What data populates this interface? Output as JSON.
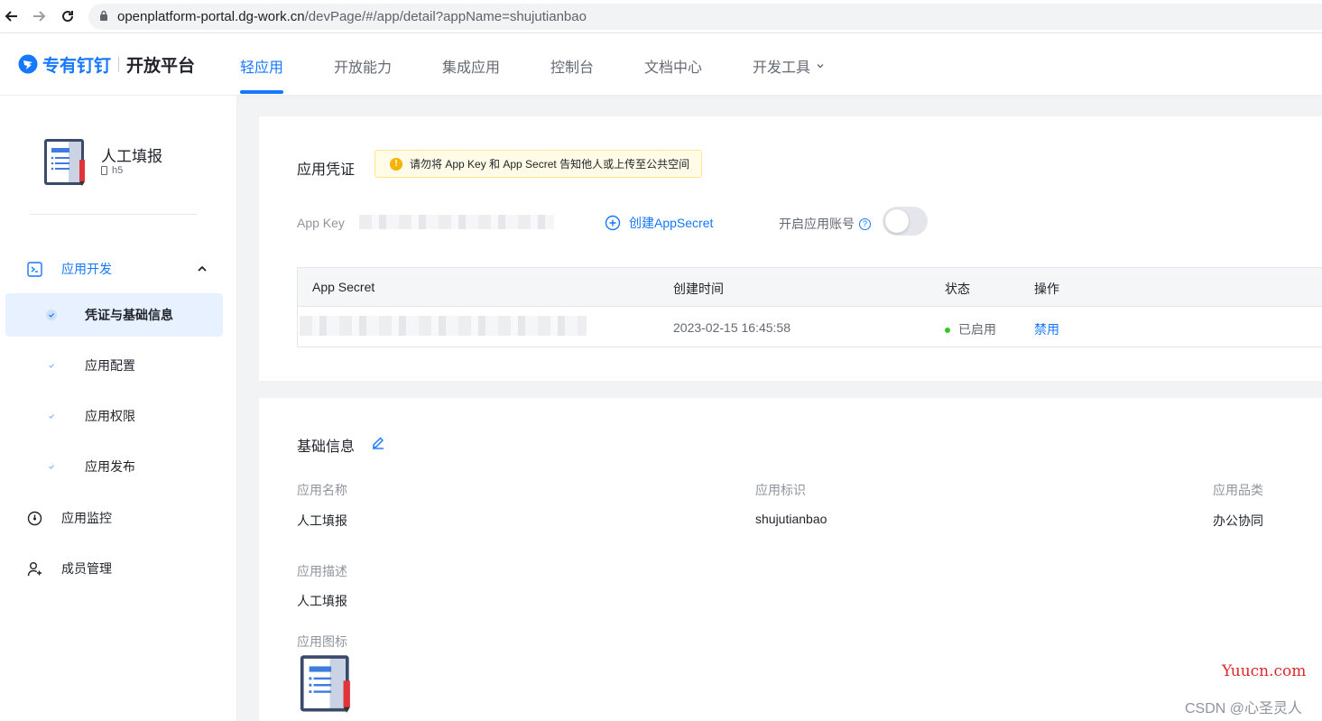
{
  "browser": {
    "url_host": "openplatform-portal.dg-work.cn",
    "url_path": "/devPage/#/app/detail?appName=shujutianbao"
  },
  "topnav": {
    "brand": "专有钉钉",
    "brand_sub": "开放平台",
    "items": [
      "轻应用",
      "开放能力",
      "集成应用",
      "控制台",
      "文档中心",
      "开发工具"
    ],
    "active_index": 0
  },
  "sidebar": {
    "app_name": "人工填报",
    "app_type": "h5",
    "groups": {
      "dev": "应用开发",
      "monitor": "应用监控",
      "members": "成员管理"
    },
    "sub_items": [
      "凭证与基础信息",
      "应用配置",
      "应用权限",
      "应用发布"
    ],
    "active_sub_index": 0
  },
  "credentials": {
    "title": "应用凭证",
    "warning": "请勿将 App Key 和 App Secret 告知他人或上传至公共空间",
    "app_key_label": "App Key",
    "create_secret": "创建AppSecret",
    "enable_account": "开启应用账号",
    "enable_account_on": false,
    "table": {
      "headers": [
        "App Secret",
        "创建时间",
        "状态",
        "操作"
      ],
      "rows": [
        {
          "created": "2023-02-15 16:45:58",
          "status": "已启用",
          "action": "禁用"
        }
      ]
    }
  },
  "basic": {
    "title": "基础信息",
    "name_label": "应用名称",
    "name_value": "人工填报",
    "id_label": "应用标识",
    "id_value": "shujutianbao",
    "category_label": "应用品类",
    "category_value": "办公协同",
    "desc_label": "应用描述",
    "desc_value": "人工填报",
    "icon_label": "应用图标"
  },
  "watermarks": {
    "site": "Yuucn.com",
    "author": "CSDN @心圣灵人"
  },
  "colors": {
    "accent": "#1677ff",
    "status_ok": "#34c724",
    "warning_bg": "#fffbe6"
  }
}
